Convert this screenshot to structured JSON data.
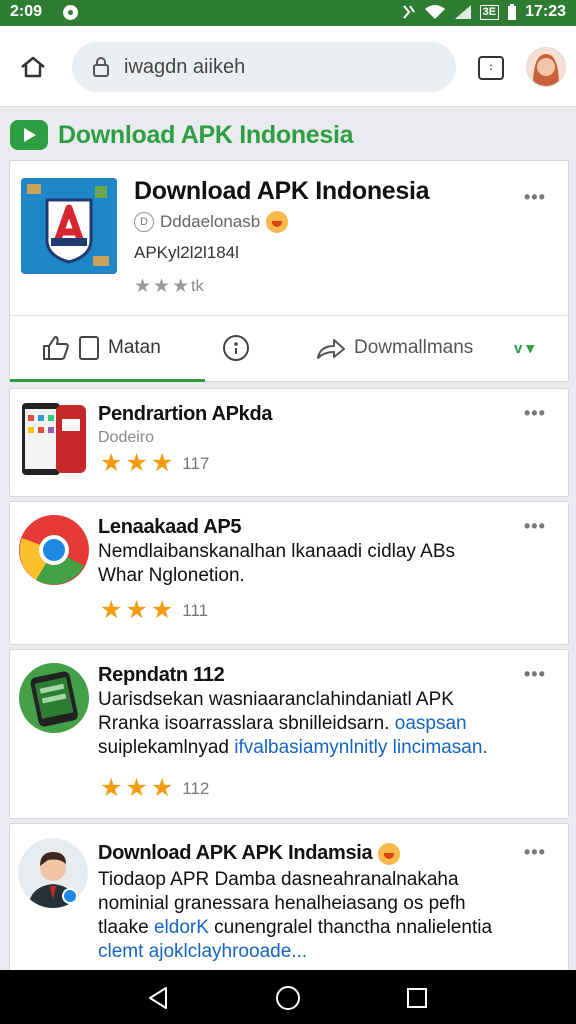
{
  "status": {
    "time_left": "2:09",
    "time_right": "17:23",
    "box_label": "3E"
  },
  "browser": {
    "url": "iwagdn aiikeh",
    "tabs_count": ":"
  },
  "section": {
    "title": "Download APK Indonesia"
  },
  "app": {
    "title": "Download APK Indonesia",
    "developer": "Dddaelonasb",
    "version": "APKyl2l2l184l",
    "rating_label": "tk",
    "actions": {
      "like_label": "Matan",
      "download_label": "Dowmallmans",
      "more_label": "v ▾"
    }
  },
  "items": [
    {
      "title": "Pendrartion APkda",
      "subtitle": "Dodeiro",
      "count": "117"
    },
    {
      "title": "Lenaakaad AP5",
      "desc_1": "Nemdlaibanskanalhan lkanaadi cidlay ABs",
      "desc_2": "Whar Nglonetion.",
      "count": "111"
    },
    {
      "title": "Repndatn 112",
      "desc_1": "Uarisdsekan wasniaaranclahindaniatl APK",
      "desc_2a": "Rranka isoarrasslara sbnilleidsarn. ",
      "desc_2_link": "oaspsan",
      "desc_3a": "suiplekamlnyad ",
      "desc_3_link": "ifvalbasiamynlnitly lincimasan.",
      "count": "112"
    },
    {
      "title": "Download APK APK Indamsia",
      "desc_1": "Tiodaop APR Damba dasneahranalnakaha",
      "desc_2": "nominial granessara henalheiasang os pefh",
      "desc_3a": "tlaake ",
      "desc_3_link": "eldorK",
      "desc_3b": " cunengralel thanctha nnalielentia",
      "desc_4_link": "clemt ajoklclayhrooade..."
    }
  ],
  "colors": {
    "accent": "#2e9e43",
    "status_bar": "#2e7d32",
    "star": "#f39c12",
    "link": "#1565c0"
  }
}
